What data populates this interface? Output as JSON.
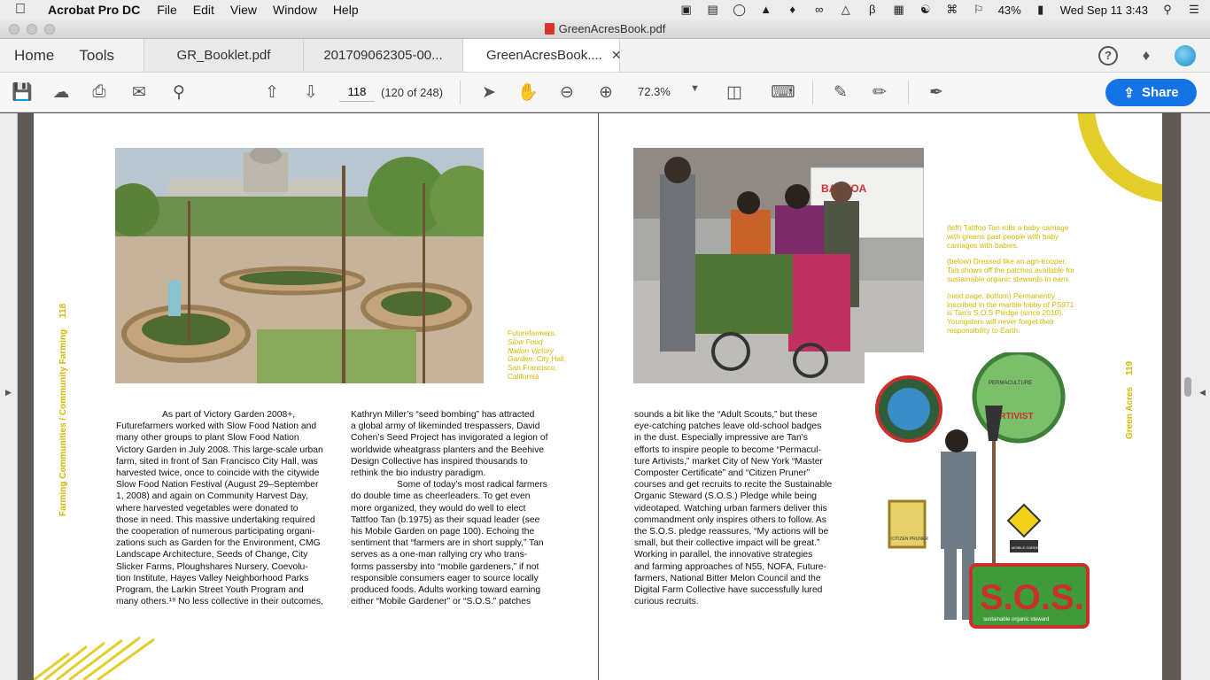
{
  "menubar": {
    "app_name": "Acrobat Pro DC",
    "items": [
      "File",
      "Edit",
      "View",
      "Window",
      "Help"
    ],
    "battery": "43%",
    "clock": "Wed Sep 11  3:43"
  },
  "window": {
    "title": "GreenAcresBook.pdf"
  },
  "tabs": {
    "home": "Home",
    "tools": "Tools",
    "documents": [
      "GR_Booklet.pdf",
      "201709062305-00...",
      "GreenAcresBook...."
    ]
  },
  "toolbar": {
    "page_number": "118",
    "page_count": "(120 of 248)",
    "zoom": "72.3%",
    "share_label": "Share"
  },
  "left_page": {
    "running_head": "Farming Communities / Community Farming",
    "page_number": "118",
    "caption": {
      "line1": "Futurefarmers,",
      "line2": "Slow Food",
      "line3": "Nation Victory",
      "line4_italic": "Garden",
      "line4_rest": ", City Hall,",
      "line5": "San Francisco,",
      "line6": "California"
    },
    "col1": [
      "As part of Victory Garden 2008+,",
      "Futurefarmers worked with Slow Food Nation and",
      "many other groups to plant Slow Food Nation",
      "Victory Garden in July 2008. This large-scale urban",
      "farm, sited in front of San Francisco City Hall, was",
      "harvested twice, once to coincide with the citywide",
      "Slow Food Nation Festival (August 29–September",
      "1, 2008) and again on Community Harvest Day,",
      "where harvested vegetables were donated to",
      "those in need. This massive undertaking required",
      "the cooperation of numerous participating organi-",
      "zations such as Garden for the Environment, CMG",
      "Landscape Architecture, Seeds of Change, City",
      "Slicker Farms, Ploughshares Nursery, Coevolu-",
      "tion Institute, Hayes Valley Neighborhood Parks",
      "Program, the Larkin Street Youth Program and",
      "many others.¹⁹ No less collective in their outcomes,"
    ],
    "col2": [
      "Kathryn Miller’s “seed bombing” has attracted",
      "a global army of likeminded trespassers, David",
      "Cohen’s Seed Project has invigorated a legion of",
      "worldwide wheatgrass planters and the Beehive",
      "Design Collective has inspired thousands to",
      "rethink the bio industry paradigm.",
      "Some of today’s most radical farmers",
      "do double time as cheerleaders. To get even",
      "more organized, they would do well to elect",
      "Tattfoo Tan (b.1975) as their squad leader (see",
      "his Mobile Garden on page 100). Echoing the",
      "sentiment that “farmers are in short supply,” Tan",
      "serves as a one-man rallying cry who trans-",
      "forms passersby into “mobile gardeners,” if not",
      "responsible consumers eager to source locally",
      "produced foods. Adults working toward earning",
      "either “Mobile Gardener” or “S.O.S.” patches"
    ]
  },
  "right_page": {
    "running_head": "Green Acres",
    "page_number": "119",
    "caption": [
      "(left) Tattfoo Tan rolls a baby carriage",
      "with greens past people with baby",
      "carriages with babies.",
      "",
      "(below) Dressed like an agri-trooper,",
      "Tan shows off the patches available for",
      "sustainable organic stewards to earn.",
      "",
      "(next page, bottom) Permanently",
      "inscribed in the marble lobby of PS971",
      "is Tan’s S.O.S Pledge (since 2010).",
      "Youngsters will never forget their",
      "responsibility to Earth."
    ],
    "col1": [
      "sounds a bit like the “Adult Scouts,” but these",
      "eye-catching patches leave old-school badges",
      "in the dust. Especially impressive are Tan’s",
      "efforts to inspire people to become “Permacul-",
      "ture Artivists,” market City of New York “Master",
      "Composter Certificate” and “Citizen Pruner”",
      "courses and get recruits to recite the Sustainable",
      "Organic Steward (S.O.S.) Pledge while being",
      "videotaped. Watching urban farmers deliver this",
      "commandment only inspires others to follow. As",
      "the S.O.S. pledge reassures, “My actions will be",
      "small, but their collective impact will be great.”",
      "Working in parallel, the innovative strategies",
      "and farming approaches of N55, NOFA, Future-",
      "farmers, National Bitter Melon Council and the",
      "Digital Farm Collective have successfully lured",
      "curious recruits."
    ],
    "patches": {
      "artivist": "ARTIVIST",
      "permaculture": "PERMACULTURE",
      "sos": "S.O.S.",
      "sos_sub": "sustainable organic steward",
      "citizen_pruner": "CITIZEN PRUNER",
      "mobile_gardener": "MOBILE GARDENER"
    },
    "truck_sign": "BALBOA"
  },
  "colors": {
    "accent_yellow": "#d4b800",
    "share_blue": "#1473e6"
  }
}
